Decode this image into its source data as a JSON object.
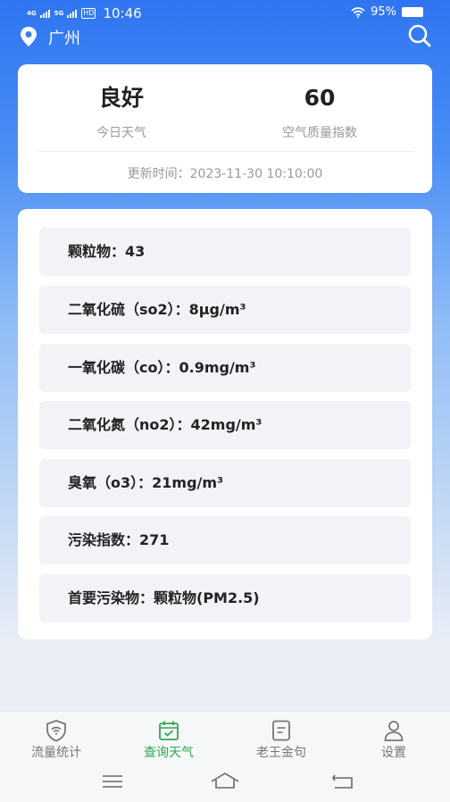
{
  "status_bar": {
    "signal1": "4G",
    "signal2": "5G",
    "hd": "HD",
    "time": "10:46",
    "battery": "95%"
  },
  "header": {
    "city": "广州",
    "icons": [
      "location-pin-icon",
      "search-icon"
    ]
  },
  "summary": {
    "air_quality": "良好",
    "air_quality_label": "今日天气",
    "aqi": "60",
    "aqi_label": "空气质量指数",
    "updated": "更新时间：2023-11-30 10:10:00"
  },
  "details": [
    "颗粒物：43",
    "二氧化硫（so2）：8μg/m³",
    "一氧化碳（co）：0.9mg/m³",
    "二氧化氮（no2）：42mg/m³",
    "臭氧（o3）：21mg/m³",
    "污染指数：271",
    "首要污染物：颗粒物(PM2.5)"
  ],
  "tabs": [
    {
      "label": "流量统计",
      "icon": "shield-wifi-icon"
    },
    {
      "label": "查询天气",
      "icon": "calendar-check-icon"
    },
    {
      "label": "老王金句",
      "icon": "document-icon"
    },
    {
      "label": "设置",
      "icon": "person-icon"
    }
  ],
  "active_tab": "查询天气",
  "colors": {
    "primary_blue": "#2f75f2",
    "active_green": "#2fa84f",
    "card_bg": "#ffffff",
    "row_bg": "#f2f3f7"
  },
  "system_nav": [
    "menu-icon",
    "home-icon",
    "back-icon"
  ]
}
